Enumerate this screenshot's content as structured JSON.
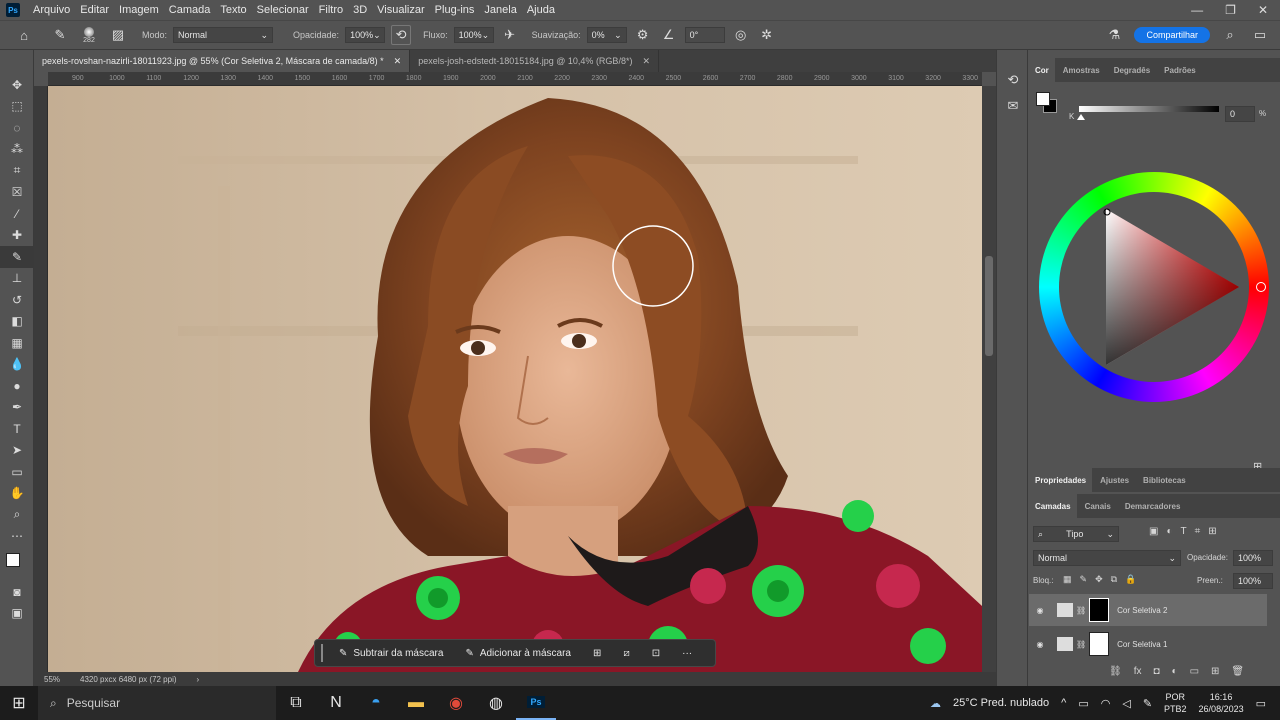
{
  "app": {
    "logo": "Ps"
  },
  "menu": [
    "Arquivo",
    "Editar",
    "Imagem",
    "Camada",
    "Texto",
    "Selecionar",
    "Filtro",
    "3D",
    "Visualizar",
    "Plug-ins",
    "Janela",
    "Ajuda"
  ],
  "window_controls": [
    "—",
    "❐",
    "✕"
  ],
  "options": {
    "brush_size": "282",
    "mode_label": "Modo:",
    "mode_value": "Normal",
    "opacity_label": "Opacidade:",
    "opacity_value": "100%",
    "flow_label": "Fluxo:",
    "flow_value": "100%",
    "smoothing_label": "Suavização:",
    "smoothing_value": "0%",
    "angle_value": "0°",
    "share_label": "Compartilhar"
  },
  "tabs": [
    {
      "label": "pexels-rovshan-nazirli-18011923.jpg @ 55% (Cor Seletiva 2, Máscara de camada/8) *",
      "active": true
    },
    {
      "label": "pexels-josh-edstedt-18015184.jpg @ 10,4% (RGB/8*)",
      "active": false
    }
  ],
  "ruler_ticks": [
    "900",
    "1000",
    "1100",
    "1200",
    "1300",
    "1400",
    "1500",
    "1600",
    "1700",
    "1800",
    "1900",
    "2000",
    "2100",
    "2200",
    "2300",
    "2400",
    "2500",
    "2600",
    "2700",
    "2800",
    "2900",
    "3000",
    "3100",
    "3200",
    "3300"
  ],
  "status": {
    "zoom": "55%",
    "doc_size": "4320 pxcx 6480 px (72 ppi)"
  },
  "context_bar": {
    "subtract": "Subtrair da máscara",
    "add": "Adicionar à máscara",
    "more": "···"
  },
  "color_panel": {
    "tabs": [
      "Cor",
      "Amostras",
      "Degradês",
      "Padrões"
    ],
    "slider_label": "K",
    "slider_value": "0",
    "slider_unit": "%"
  },
  "props_tabs": [
    "Propriedades",
    "Ajustes",
    "Bibliotecas"
  ],
  "layers_panel": {
    "tabs": [
      "Camadas",
      "Canais",
      "Demarcadores"
    ],
    "filter_label": "Tipo",
    "blend_mode": "Normal",
    "opacity_label": "Opacidade:",
    "opacity_value": "100%",
    "lock_label": "Bloq.:",
    "fill_label": "Preen.:",
    "fill_value": "100%",
    "layers": [
      {
        "name": "Cor Seletiva 2",
        "selected": true
      },
      {
        "name": "Cor Seletiva 1",
        "selected": false
      }
    ]
  },
  "taskbar": {
    "search_placeholder": "Pesquisar",
    "weather": "25°C  Pred. nublado",
    "lang_top": "POR",
    "lang_bottom": "PTB2",
    "time": "16:16",
    "date": "26/08/2023"
  },
  "colors": {
    "accent": "#1473e6",
    "panel": "#535353",
    "dark": "#3b3b3b"
  }
}
